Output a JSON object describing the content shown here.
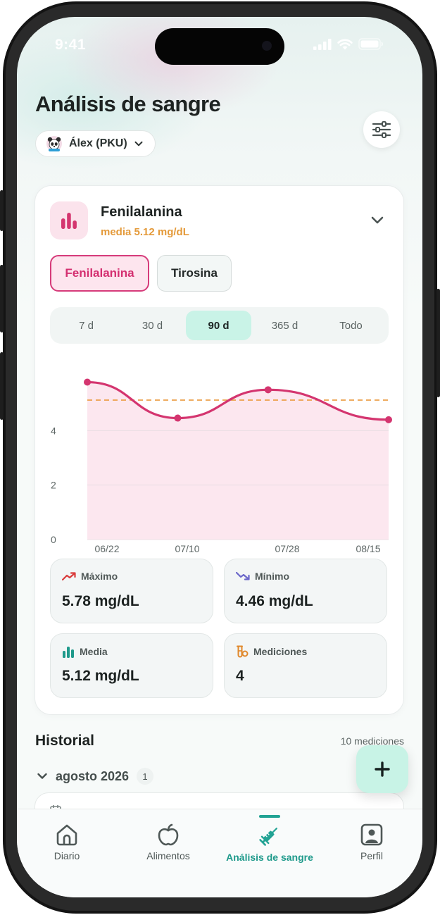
{
  "status_bar": {
    "time": "9:41"
  },
  "header": {
    "title": "Análisis de sangre",
    "patient_label": "Álex (PKU)"
  },
  "metric_card": {
    "name": "Fenilalanina",
    "mean_text": "media 5.12 mg/dL",
    "tabs": [
      {
        "label": "Fenilalanina",
        "active": true
      },
      {
        "label": "Tirosina",
        "active": false
      }
    ],
    "ranges": [
      {
        "label": "7 d",
        "active": false
      },
      {
        "label": "30 d",
        "active": false
      },
      {
        "label": "90 d",
        "active": true
      },
      {
        "label": "365 d",
        "active": false
      },
      {
        "label": "Todo",
        "active": false
      }
    ]
  },
  "chart_data": {
    "type": "area",
    "x": [
      "06/16",
      "07/04",
      "07/22",
      "08/15"
    ],
    "values": [
      5.78,
      4.46,
      5.5,
      4.4
    ],
    "mean_line": 5.12,
    "x_tick_labels": [
      "06/22",
      "07/10",
      "07/28",
      "08/15"
    ],
    "y_tick_labels": [
      "0",
      "2",
      "4"
    ],
    "ylim": [
      0,
      6
    ],
    "grid": true,
    "colors": {
      "line": "#d4356f",
      "fill": "#fbe3ec",
      "mean": "#eba04a"
    }
  },
  "stats": [
    {
      "icon": "trend-up-icon",
      "label": "Máximo",
      "value": "5.78 mg/dL"
    },
    {
      "icon": "trend-down-icon",
      "label": "Mínimo",
      "value": "4.46 mg/dL"
    },
    {
      "icon": "bar-chart-icon",
      "label": "Media",
      "value": "5.12 mg/dL"
    },
    {
      "icon": "vial-icon",
      "label": "Mediciones",
      "value": "4"
    }
  ],
  "history": {
    "title": "Historial",
    "count_text": "10 mediciones",
    "month_label": "agosto 2026",
    "month_count": "1"
  },
  "fab": {
    "icon": "plus-icon"
  },
  "tabbar": [
    {
      "icon": "home-icon",
      "label": "Diario",
      "active": false
    },
    {
      "icon": "apple-icon",
      "label": "Alimentos",
      "active": false
    },
    {
      "icon": "syringe-icon",
      "label": "Análisis de sangre",
      "active": true
    },
    {
      "icon": "profile-icon",
      "label": "Perfil",
      "active": false
    }
  ],
  "colors": {
    "accent_pink": "#d42f70",
    "accent_teal": "#1f9a8b",
    "mean_orange": "#e49a3a"
  }
}
